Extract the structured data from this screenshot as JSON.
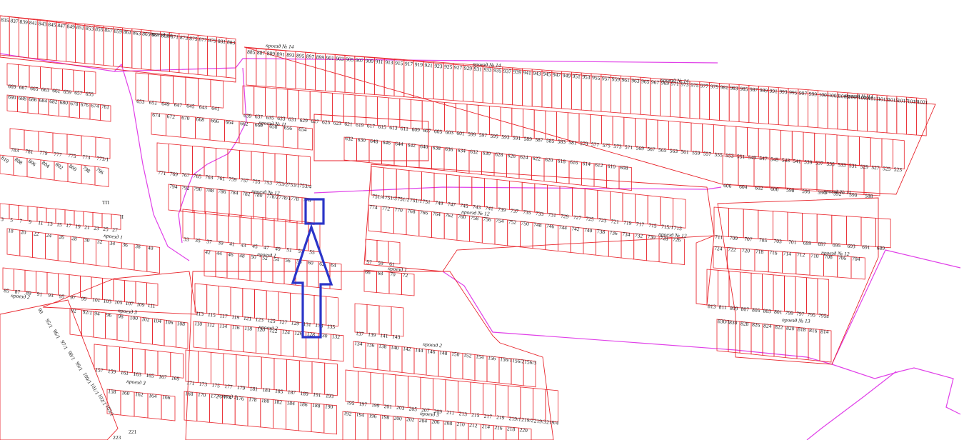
{
  "colors": {
    "plot_line": "#e8252c",
    "boundary_line": "#e040e8",
    "marker": "#2b35c8",
    "label": "#1a1a1a",
    "background": "#ffffff"
  },
  "streets": {
    "p14_a": "проезд 14",
    "p14_b": "проезд № 14",
    "p14_c": "проезд № 14",
    "p14_d": "проезд № 14",
    "p14_e": "проезд № 14",
    "p11_a": "проезд № 11",
    "p11_b": "проезд № 11",
    "p12_a": "проезд № 12",
    "p12_b": "проезд № 12",
    "p12_c": "проезд № 12",
    "p12_d": "проезд № 12",
    "p13": "проезд № 13",
    "p1_a": "проезд 1",
    "p1_b": "проезд 1",
    "p1_c": "проезд 1",
    "p2_a": "проезд 2",
    "p2_b": "проезд 2",
    "p2_c": "проезд 2",
    "p3_a": "проезд 3",
    "p3_b": "проезд 3",
    "p3_c": "проезд 3"
  },
  "rows": [
    {
      "id": "r14top",
      "labels": [
        "835",
        "837",
        "839",
        "841",
        "843",
        "845",
        "847",
        "849",
        "851",
        "853",
        "855",
        "857",
        "859",
        "861",
        "863",
        "865",
        "867",
        "869",
        "871",
        "873",
        "875",
        "877",
        "879",
        "881",
        "883"
      ]
    },
    {
      "id": "r14mid",
      "labels": [
        "885",
        "887",
        "889",
        "891",
        "893",
        "895",
        "897",
        "899",
        "901",
        "903",
        "905",
        "907",
        "909",
        "911",
        "913",
        "915",
        "917",
        "919",
        "921",
        "923",
        "925",
        "927",
        "929",
        "931",
        "933",
        "935",
        "937",
        "939",
        "941",
        "943",
        "945",
        "947",
        "949",
        "951",
        "953",
        "955",
        "957",
        "959",
        "961",
        "963",
        "965",
        "967",
        "969",
        "971",
        "973",
        "975",
        "977",
        "979",
        "981",
        "983",
        "985",
        "987",
        "989",
        "991",
        "993",
        "995",
        "997",
        "999",
        "1001",
        "1003",
        "1005",
        "1007",
        "1009",
        "1011",
        "1013",
        "1015",
        "1017",
        "1019",
        "1021"
      ]
    },
    {
      "id": "r653",
      "labels": [
        "653",
        "651",
        "649",
        "647",
        "645",
        "643",
        "641"
      ]
    },
    {
      "id": "r669",
      "labels": [
        "669",
        "667",
        "665",
        "663",
        "661",
        "659",
        "657",
        "655"
      ]
    },
    {
      "id": "r690",
      "labels": [
        "690",
        "688",
        "686",
        "684",
        "682",
        "680",
        "678",
        "676",
        "674",
        "761"
      ]
    },
    {
      "id": "r639",
      "labels": [
        "639",
        "637",
        "635",
        "633",
        "631",
        "629",
        "627",
        "625",
        "623",
        "621",
        "619",
        "617",
        "615",
        "613",
        "611",
        "609",
        "607",
        "605",
        "603",
        "601",
        "599",
        "597",
        "595",
        "593",
        "591",
        "589",
        "587",
        "585",
        "583",
        "581",
        "579",
        "577",
        "575",
        "573",
        "571",
        "569",
        "567",
        "565",
        "563",
        "561",
        "559",
        "557",
        "555",
        "553",
        "551",
        "549",
        "547",
        "545",
        "543",
        "541",
        "539",
        "537",
        "535",
        "533",
        "531",
        "529",
        "527",
        "525",
        "523"
      ]
    },
    {
      "id": "r674",
      "labels": [
        "674",
        "672",
        "670",
        "668",
        "666",
        "664",
        "662",
        "660",
        "658",
        "656",
        "654"
      ]
    },
    {
      "id": "r632",
      "labels": [
        "632",
        "630",
        "648",
        "646",
        "644",
        "642",
        "640",
        "638",
        "636",
        "634",
        "632",
        "630",
        "628",
        "626",
        "624",
        "622",
        "620",
        "618",
        "616",
        "614",
        "612",
        "610",
        "608"
      ]
    },
    {
      "id": "r783",
      "labels": [
        "783",
        "781",
        "779",
        "777",
        "775",
        "773",
        "773/1"
      ]
    },
    {
      "id": "r810",
      "labels": [
        "810",
        "808",
        "806",
        "804",
        "802",
        "800",
        "798",
        "796"
      ]
    },
    {
      "id": "r769",
      "labels": [
        "771",
        "769",
        "767",
        "765",
        "763",
        "761",
        "759",
        "757",
        "755",
        "753",
        "753/2",
        "753/1",
        "753/4"
      ]
    },
    {
      "id": "r794",
      "labels": [
        "794",
        "792",
        "790",
        "788",
        "786",
        "784",
        "782",
        "780",
        "778/2",
        "778/1",
        "778",
        "776"
      ]
    },
    {
      "id": "r751",
      "labels": [
        "751/4",
        "751/3",
        "751/2",
        "751/1",
        "751",
        "749",
        "747",
        "745",
        "743",
        "741",
        "739",
        "737",
        "735",
        "733",
        "731",
        "729",
        "727",
        "725",
        "723",
        "721",
        "719",
        "717",
        "715",
        "715/1",
        "713"
      ]
    },
    {
      "id": "r774",
      "labels": [
        "774",
        "772",
        "770",
        "768",
        "766",
        "764",
        "762",
        "760",
        "758",
        "756",
        "754",
        "752",
        "750",
        "748",
        "746",
        "744",
        "742",
        "740",
        "738",
        "736",
        "734",
        "732",
        "730",
        "728",
        "726"
      ]
    },
    {
      "id": "r606",
      "labels": [
        "606",
        "604",
        "602",
        "600",
        "598",
        "596",
        "594",
        "592",
        "590",
        "588"
      ]
    },
    {
      "id": "r711",
      "labels": [
        "711",
        "709",
        "707",
        "705",
        "703",
        "701",
        "699",
        "697",
        "695",
        "693",
        "691",
        "689"
      ]
    },
    {
      "id": "r724",
      "labels": [
        "724",
        "722",
        "720",
        "718",
        "716",
        "714",
        "712",
        "710",
        "708",
        "706",
        "704"
      ]
    },
    {
      "id": "r813",
      "labels": [
        "813",
        "811",
        "809",
        "807",
        "805",
        "803",
        "801",
        "799",
        "797",
        "795",
        "795a"
      ]
    },
    {
      "id": "r830",
      "labels": [
        "830/1",
        "830",
        "828",
        "826",
        "824",
        "822",
        "820",
        "818",
        "816",
        "814"
      ]
    },
    {
      "id": "r3",
      "labels": [
        "3",
        "5",
        "7",
        "9",
        "11",
        "13",
        "15",
        "17",
        "19",
        "21",
        "23",
        "25",
        "27"
      ]
    },
    {
      "id": "r18",
      "labels": [
        "18",
        "20",
        "22",
        "24",
        "26",
        "28",
        "30",
        "32",
        "34",
        "36",
        "38",
        "40"
      ]
    },
    {
      "id": "r33",
      "labels": [
        "33",
        "35",
        "37",
        "39",
        "41",
        "43",
        "45",
        "47",
        "49",
        "51",
        "53",
        "55"
      ]
    },
    {
      "id": "r42",
      "labels": [
        "42",
        "44",
        "46",
        "48",
        "50",
        "52",
        "54",
        "56",
        "58",
        "60",
        "62",
        "64"
      ]
    },
    {
      "id": "r57",
      "labels": [
        "57",
        "59",
        "61"
      ]
    },
    {
      "id": "r66",
      "labels": [
        "66",
        "68",
        "70",
        "72"
      ]
    },
    {
      "id": "r85",
      "labels": [
        "85",
        "87",
        "89",
        "91",
        "93",
        "95",
        "97",
        "99",
        "101",
        "103",
        "105",
        "107",
        "109",
        "111"
      ]
    },
    {
      "id": "r92",
      "labels": [
        "92",
        "92/1",
        "94",
        "96",
        "98",
        "100",
        "102",
        "104",
        "106",
        "108"
      ]
    },
    {
      "id": "r113",
      "labels": [
        "113",
        "115",
        "117",
        "119",
        "121",
        "123",
        "125",
        "127",
        "129",
        "131",
        "133",
        "135"
      ]
    },
    {
      "id": "r110",
      "labels": [
        "110",
        "112",
        "114",
        "116",
        "118",
        "120",
        "122",
        "124",
        "126",
        "128",
        "130",
        "132"
      ]
    },
    {
      "id": "r137",
      "labels": [
        "137",
        "139",
        "141",
        "143"
      ]
    },
    {
      "id": "r134",
      "labels": [
        "134",
        "136",
        "138",
        "140",
        "142",
        "144",
        "146",
        "148",
        "150",
        "152",
        "154",
        "156",
        "156/1",
        "156/2",
        "156/3"
      ]
    },
    {
      "id": "r157",
      "labels": [
        "157",
        "159",
        "161",
        "163",
        "165",
        "167",
        "169"
      ]
    },
    {
      "id": "r171",
      "labels": [
        "171",
        "173",
        "175",
        "177",
        "179",
        "181",
        "183",
        "185",
        "187",
        "189",
        "191",
        "193"
      ]
    },
    {
      "id": "r158",
      "labels": [
        "158",
        "160",
        "162",
        "164",
        "166"
      ]
    },
    {
      "id": "r168",
      "labels": [
        "168",
        "170",
        "172",
        "174",
        "176",
        "178",
        "180",
        "182",
        "184",
        "186",
        "188",
        "190"
      ]
    },
    {
      "id": "r195",
      "labels": [
        "195",
        "197",
        "199",
        "201",
        "203",
        "205",
        "207",
        "209",
        "211",
        "213",
        "215",
        "217",
        "219",
        "219/1",
        "219/2",
        "219/3",
        "219/4"
      ]
    },
    {
      "id": "r192",
      "labels": [
        "192",
        "194",
        "196",
        "198",
        "200",
        "202",
        "204",
        "206",
        "208",
        "210",
        "212",
        "214",
        "216",
        "218",
        "220"
      ]
    },
    {
      "id": "rdiag",
      "labels": [
        "90",
        "95/1",
        "96/1",
        "97/1",
        "98/1",
        "99/1",
        "100/1",
        "101/1",
        "102/1",
        "103/1"
      ]
    },
    {
      "id": "rmisc",
      "labels": [
        "TП",
        "II",
        "221",
        "223"
      ]
    }
  ]
}
